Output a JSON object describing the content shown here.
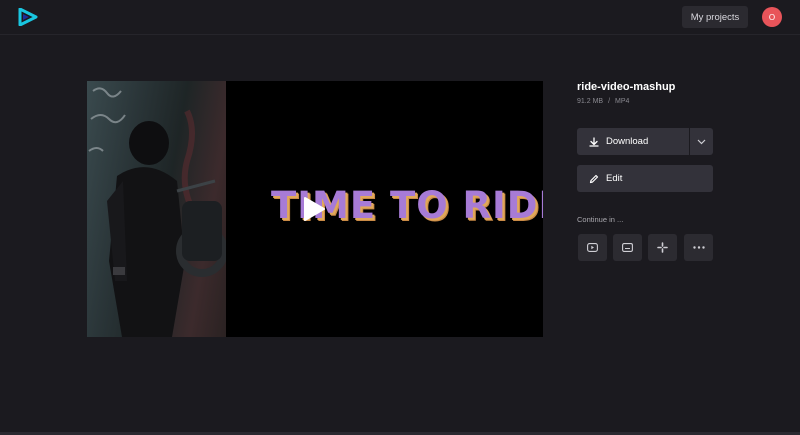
{
  "header": {
    "logo_icon": "play-logo-icon",
    "my_projects_label": "My projects",
    "avatar_initial": "O",
    "avatar_color": "#e8545a"
  },
  "video": {
    "overlay_title": "TIME TO RIDE",
    "play_icon": "play-icon"
  },
  "project": {
    "name": "ride-video-mashup",
    "size": "91.2 MB",
    "separator": "/",
    "format": "MP4"
  },
  "actions": {
    "download_label": "Download",
    "download_icon": "download-icon",
    "dropdown_icon": "chevron-down-icon",
    "edit_label": "Edit",
    "edit_icon": "pencil-icon",
    "continue_label": "Continue in ..."
  },
  "continue_targets": [
    {
      "icon": "youtube-icon"
    },
    {
      "icon": "tv-icon"
    },
    {
      "icon": "slack-icon"
    },
    {
      "icon": "more-icon"
    }
  ],
  "colors": {
    "background": "#1b1a1f",
    "accent_logo": "#19c6e0",
    "title_purple": "#a77bd6",
    "title_orange": "#e0a85a"
  }
}
